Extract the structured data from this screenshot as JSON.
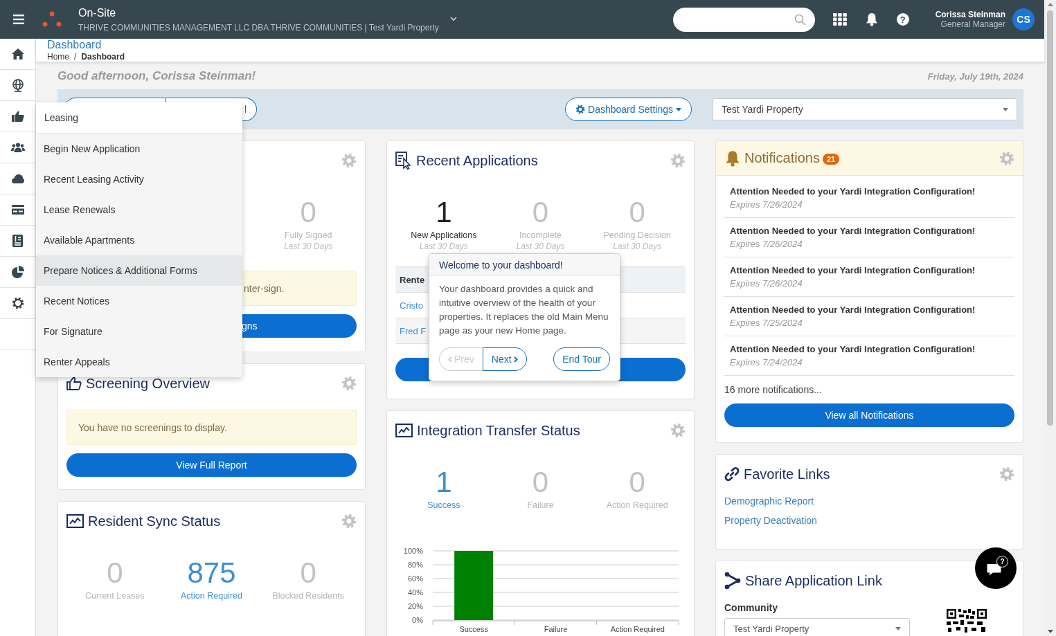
{
  "topbar": {
    "app_name": "On-Site",
    "company": "THRIVE COMMUNITIES MANAGEMENT LLC DBA THRIVE COMMUNITIES | Test Yardi Property",
    "help_glyph": "?",
    "user_name": "Corissa Steinman",
    "user_role": "General Manager",
    "avatar_initials": "CS"
  },
  "sidebar": {
    "items": [
      {
        "kind": "home"
      },
      {
        "kind": "globe"
      },
      {
        "kind": "thumb"
      },
      {
        "kind": "people"
      },
      {
        "kind": "cloud"
      },
      {
        "kind": "card"
      },
      {
        "kind": "document"
      },
      {
        "kind": "pie"
      },
      {
        "kind": "gear"
      },
      {
        "kind": "blank"
      }
    ]
  },
  "header": {
    "title": "Dashboard",
    "breadcrumb": [
      "Home",
      "Dashboard"
    ],
    "separator": "/"
  },
  "greeting": "Good afternoon, Corissa Steinman!",
  "date": "Friday, July 19th, 2024",
  "toolbar": {
    "segment_text": "l",
    "settings_button": "Dashboard Settings",
    "property_select": "Test Yardi Property"
  },
  "leasing_menu": {
    "title": "Leasing",
    "items": [
      {
        "label": "Begin New Application",
        "selected": false
      },
      {
        "label": "Recent Leasing Activity",
        "selected": false
      },
      {
        "label": "Lease Renewals",
        "selected": false
      },
      {
        "label": "Available Apartments",
        "selected": false
      },
      {
        "label": "Prepare Notices & Additional Forms",
        "selected": true
      },
      {
        "label": "Recent Notices",
        "selected": false
      },
      {
        "label": "For Signature",
        "selected": false
      },
      {
        "label": "Renter Appeals",
        "selected": false
      }
    ]
  },
  "leasing_card": {
    "stat": {
      "value": "0",
      "label": "Fully Signed",
      "period": "Last 30 Days",
      "kind": "muted"
    },
    "alert": "nter-sign.",
    "button": "gns"
  },
  "screening": {
    "title": "Screening Overview",
    "alert": "You have no screenings to display.",
    "button": "View Full Report"
  },
  "resident_sync": {
    "title": "Resident Sync Status",
    "stats": [
      {
        "value": "0",
        "label": "Current Leases",
        "kind": "muted"
      },
      {
        "value": "875",
        "label": "Action Required",
        "kind": "link"
      },
      {
        "value": "0",
        "label": "Blocked Residents",
        "kind": "muted"
      }
    ]
  },
  "recent_apps": {
    "title": "Recent Applications",
    "stats": [
      {
        "value": "1",
        "label": "New Applications",
        "period": "Last 30 Days",
        "kind": "dark"
      },
      {
        "value": "0",
        "label": "Incomplete",
        "period": "Last 30 Days",
        "kind": "muted"
      },
      {
        "value": "0",
        "label": "Pending Decision",
        "period": "Last 30 Days",
        "kind": "muted"
      }
    ],
    "table_header": "Rente",
    "rows": [
      "Cristo",
      "Fred F"
    ]
  },
  "tour": {
    "title": "Welcome to your dashboard!",
    "body": "Your dashboard provides a quick and intuitive overview of the health of your properties. It replaces the old Main Menu page as your new Home page.",
    "prev": "Prev",
    "prev_disabled": true,
    "next": "Next",
    "end": "End Tour"
  },
  "integration": {
    "title": "Integration Transfer Status",
    "stats": [
      {
        "value": "1",
        "label": "Success",
        "kind": "link"
      },
      {
        "value": "0",
        "label": "Failure",
        "kind": "muted"
      },
      {
        "value": "0",
        "label": "Action Required",
        "kind": "muted"
      }
    ],
    "chart_data": {
      "type": "bar",
      "grid": true,
      "categories": [
        "Success",
        "Failure",
        "Action Required"
      ],
      "series": [
        {
          "color": "#008000",
          "values": [
            100,
            0,
            0
          ]
        }
      ],
      "ylim": [
        0,
        100
      ],
      "yticks": [
        {
          "value": 0,
          "label": "0%"
        },
        {
          "value": 20,
          "label": "20%"
        },
        {
          "value": 40,
          "label": "40%"
        },
        {
          "value": 60,
          "label": "60%"
        },
        {
          "value": 80,
          "label": "80%"
        },
        {
          "value": 100,
          "label": "100%"
        }
      ]
    }
  },
  "notifications": {
    "title": "Notifications",
    "badge": "21",
    "items": [
      {
        "title": "Attention Needed to your Yardi Integration Configuration!",
        "expires": "Expires 7/26/2024"
      },
      {
        "title": "Attention Needed to your Yardi Integration Configuration!",
        "expires": "Expires 7/26/2024"
      },
      {
        "title": "Attention Needed to your Yardi Integration Configuration!",
        "expires": "Expires 7/26/2024"
      },
      {
        "title": "Attention Needed to your Yardi Integration Configuration!",
        "expires": "Expires 7/25/2024"
      },
      {
        "title": "Attention Needed to your Yardi Integration Configuration!",
        "expires": "Expires 7/24/2024"
      }
    ],
    "more": "16 more notifications...",
    "button": "View all Notifications"
  },
  "favorites": {
    "title": "Favorite Links",
    "links": [
      "Demographic Report",
      "Property Deactivation"
    ]
  },
  "share": {
    "title": "Share Application Link",
    "field_label": "Community",
    "community": "Test Yardi Property"
  },
  "chat": {
    "glyph": "?"
  }
}
